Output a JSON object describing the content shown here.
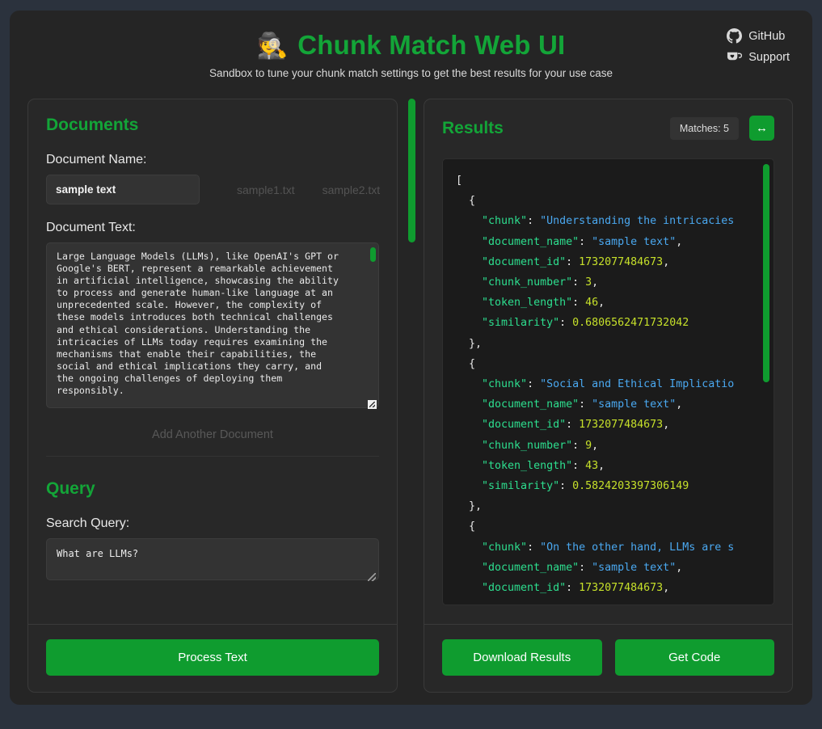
{
  "header": {
    "emoji": "🕵️",
    "title": "Chunk Match Web UI",
    "subtitle": "Sandbox to tune your chunk match settings to get the best results for your use case",
    "links": [
      {
        "label": "GitHub",
        "icon": "github-icon"
      },
      {
        "label": "Support",
        "icon": "coffee-heart-icon"
      }
    ]
  },
  "documents": {
    "section_title": "Documents",
    "name_label": "Document Name:",
    "name_value": "sample text",
    "name_placeholder": "Document Name",
    "sample_files": [
      "sample1.txt",
      "sample2.txt"
    ],
    "text_label": "Document Text:",
    "text_value": "Large Language Models (LLMs), like OpenAI's GPT or\nGoogle's BERT, represent a remarkable achievement\nin artificial intelligence, showcasing the ability\nto process and generate human-like language at an\nunprecedented scale. However, the complexity of\nthese models introduces both technical challenges\nand ethical considerations. Understanding the\nintricacies of LLMs today requires examining the\nmechanisms that enable their capabilities, the\nsocial and ethical implications they carry, and\nthe ongoing challenges of deploying them\nresponsibly.",
    "text_placeholder": "Document Text",
    "add_another_label": "Add Another Document"
  },
  "query": {
    "section_title": "Query",
    "label": "Search Query:",
    "value": "What are LLMs?",
    "placeholder": "Search Query"
  },
  "actions": {
    "process_text": "Process Text",
    "download_results": "Download Results",
    "get_code": "Get Code"
  },
  "results": {
    "section_title": "Results",
    "matches_badge": "Matches: 5",
    "expand_icon": "↔",
    "lines": [
      [
        {
          "t": "p",
          "v": "["
        }
      ],
      [
        {
          "t": "p",
          "v": "  {"
        }
      ],
      [
        {
          "t": "k",
          "v": "    \"chunk\""
        },
        {
          "t": "p",
          "v": ": "
        },
        {
          "t": "s",
          "v": "\"Understanding the intricacies"
        }
      ],
      [
        {
          "t": "k",
          "v": "    \"document_name\""
        },
        {
          "t": "p",
          "v": ": "
        },
        {
          "t": "s",
          "v": "\"sample text\""
        },
        {
          "t": "p",
          "v": ","
        }
      ],
      [
        {
          "t": "k",
          "v": "    \"document_id\""
        },
        {
          "t": "p",
          "v": ": "
        },
        {
          "t": "n",
          "v": "1732077484673"
        },
        {
          "t": "p",
          "v": ","
        }
      ],
      [
        {
          "t": "k",
          "v": "    \"chunk_number\""
        },
        {
          "t": "p",
          "v": ": "
        },
        {
          "t": "n",
          "v": "3"
        },
        {
          "t": "p",
          "v": ","
        }
      ],
      [
        {
          "t": "k",
          "v": "    \"token_length\""
        },
        {
          "t": "p",
          "v": ": "
        },
        {
          "t": "n",
          "v": "46"
        },
        {
          "t": "p",
          "v": ","
        }
      ],
      [
        {
          "t": "k",
          "v": "    \"similarity\""
        },
        {
          "t": "p",
          "v": ": "
        },
        {
          "t": "n",
          "v": "0.6806562471732042"
        }
      ],
      [
        {
          "t": "p",
          "v": "  },"
        }
      ],
      [
        {
          "t": "p",
          "v": "  {"
        }
      ],
      [
        {
          "t": "k",
          "v": "    \"chunk\""
        },
        {
          "t": "p",
          "v": ": "
        },
        {
          "t": "s",
          "v": "\"Social and Ethical Implicatio"
        }
      ],
      [
        {
          "t": "k",
          "v": "    \"document_name\""
        },
        {
          "t": "p",
          "v": ": "
        },
        {
          "t": "s",
          "v": "\"sample text\""
        },
        {
          "t": "p",
          "v": ","
        }
      ],
      [
        {
          "t": "k",
          "v": "    \"document_id\""
        },
        {
          "t": "p",
          "v": ": "
        },
        {
          "t": "n",
          "v": "1732077484673"
        },
        {
          "t": "p",
          "v": ","
        }
      ],
      [
        {
          "t": "k",
          "v": "    \"chunk_number\""
        },
        {
          "t": "p",
          "v": ": "
        },
        {
          "t": "n",
          "v": "9"
        },
        {
          "t": "p",
          "v": ","
        }
      ],
      [
        {
          "t": "k",
          "v": "    \"token_length\""
        },
        {
          "t": "p",
          "v": ": "
        },
        {
          "t": "n",
          "v": "43"
        },
        {
          "t": "p",
          "v": ","
        }
      ],
      [
        {
          "t": "k",
          "v": "    \"similarity\""
        },
        {
          "t": "p",
          "v": ": "
        },
        {
          "t": "n",
          "v": "0.5824203397306149"
        }
      ],
      [
        {
          "t": "p",
          "v": "  },"
        }
      ],
      [
        {
          "t": "p",
          "v": "  {"
        }
      ],
      [
        {
          "t": "k",
          "v": "    \"chunk\""
        },
        {
          "t": "p",
          "v": ": "
        },
        {
          "t": "s",
          "v": "\"On the other hand, LLMs are s"
        }
      ],
      [
        {
          "t": "k",
          "v": "    \"document_name\""
        },
        {
          "t": "p",
          "v": ": "
        },
        {
          "t": "s",
          "v": "\"sample text\""
        },
        {
          "t": "p",
          "v": ","
        }
      ],
      [
        {
          "t": "k",
          "v": "    \"document_id\""
        },
        {
          "t": "p",
          "v": ": "
        },
        {
          "t": "n",
          "v": "1732077484673"
        },
        {
          "t": "p",
          "v": ","
        }
      ]
    ]
  },
  "colors": {
    "page_bg": "#2b323d",
    "shell_bg": "#252525",
    "panel_bg": "#282828",
    "accent_green": "#0f9c2f",
    "title_green": "#13a538",
    "json_bg": "#1b1b1b",
    "key_color": "#2ddf8f",
    "string_color": "#4aa8f0",
    "number_color": "#c6e02a"
  }
}
